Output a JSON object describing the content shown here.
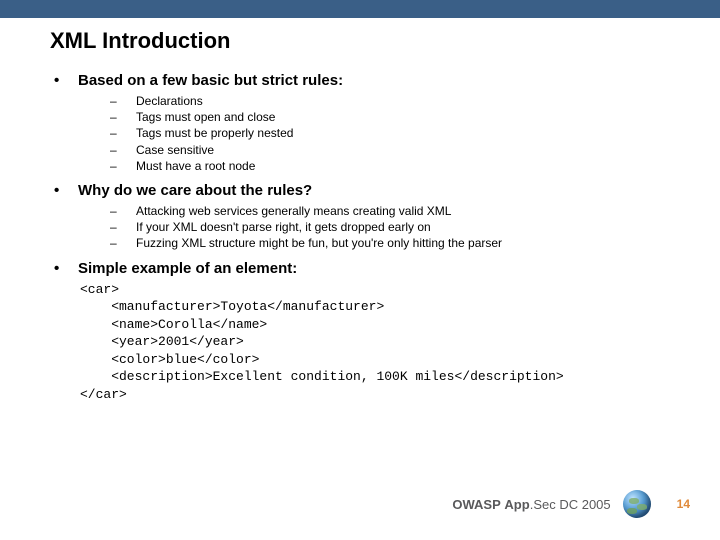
{
  "title": "XML Introduction",
  "sections": [
    {
      "heading": "Based on a few basic but strict rules:",
      "items": [
        "Declarations",
        "Tags must open and close",
        "Tags must be properly nested",
        "Case sensitive",
        "Must have a root node"
      ]
    },
    {
      "heading": "Why do we care about the rules?",
      "items": [
        "Attacking web services generally means creating valid XML",
        "If your XML doesn't parse right, it gets dropped early on",
        "Fuzzing XML structure might be fun, but you're only hitting the parser"
      ]
    },
    {
      "heading": "Simple example of an element:",
      "items": []
    }
  ],
  "code_example": "<car>\n    <manufacturer>Toyota</manufacturer>\n    <name>Corolla</name>\n    <year>2001</year>\n    <color>blue</color>\n    <description>Excellent condition, 100K miles</description>\n</car>",
  "footer": {
    "org": "OWASP",
    "event_part1": "App",
    "event_part2": "Sec DC 2005"
  },
  "page_number": "14"
}
